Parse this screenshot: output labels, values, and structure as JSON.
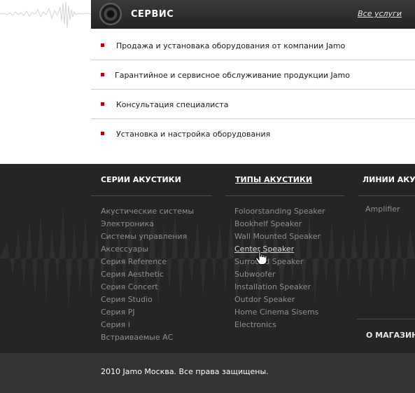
{
  "service": {
    "title": "СЕРВИС",
    "all_link": "Все услуги",
    "items": [
      "Продажа и установака оборудования от компании Jamo",
      "Гарантийное и сервисное обслуживание продукции Jamo",
      "Консультация специалиста",
      "Установка и настройка оборудования"
    ]
  },
  "footer": {
    "series": {
      "title": "СЕРИИ АКУСТИКИ",
      "links": [
        "Акустические системы",
        "Электроника",
        "Системы управления",
        "Аксессуары",
        "Серия Reference",
        "Серия Aesthetic",
        "Серия Concert",
        "Серия Studio",
        "Серия PJ",
        "Серия i",
        "Встраиваемые АС"
      ]
    },
    "types": {
      "title": "ТИПЫ АКУСТИКИ",
      "links": [
        "Foloorstanding Speaker",
        "Bookhelf Speaker",
        "Wall Mounted Speaker",
        "Center Speaker",
        "Surround Speaker",
        "Subwoofer",
        "Installation Speaker",
        "Outdor Speaker",
        "Home Cinema Sisems",
        "Electronics"
      ]
    },
    "lines": {
      "title": "ЛИНИИ АКУСТИКИ",
      "links": [
        "Amplifier"
      ]
    },
    "shop": "О МАГАЗИНЕ"
  },
  "copyright": "2010 Jamo Москва. Все права защищены.",
  "colors": {
    "bullet": "#b3000f",
    "footer_bg": "#252525",
    "header_bg": "#2a2a2a"
  }
}
